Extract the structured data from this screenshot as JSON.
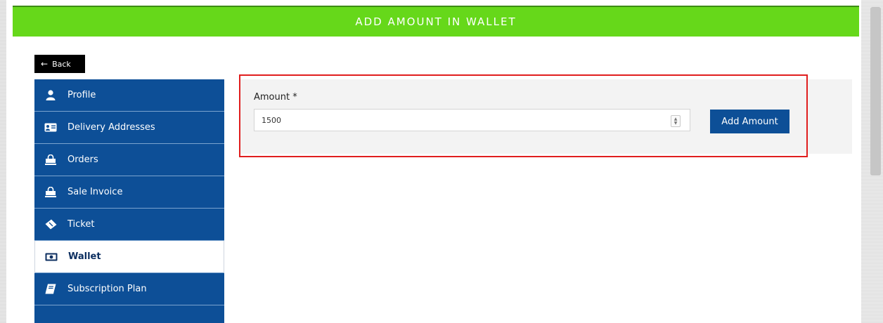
{
  "header": {
    "title": "ADD AMOUNT IN WALLET"
  },
  "back_button": {
    "label": "Back"
  },
  "sidebar": {
    "items": [
      {
        "label": "Profile",
        "icon": "user-icon"
      },
      {
        "label": "Delivery Addresses",
        "icon": "address-card-icon"
      },
      {
        "label": "Orders",
        "icon": "shopping-bag-icon"
      },
      {
        "label": "Sale Invoice",
        "icon": "shopping-bag-icon"
      },
      {
        "label": "Ticket",
        "icon": "ticket-icon"
      },
      {
        "label": "Wallet",
        "icon": "money-bill-icon",
        "active": true
      },
      {
        "label": "Subscription Plan",
        "icon": "book-icon"
      }
    ]
  },
  "form": {
    "amount_label": "Amount *",
    "amount_value": "1500",
    "submit_label": "Add Amount"
  },
  "colors": {
    "header_green": "#66d81a",
    "sidebar_blue": "#0d4f97",
    "highlight_red": "#e01e1e"
  }
}
